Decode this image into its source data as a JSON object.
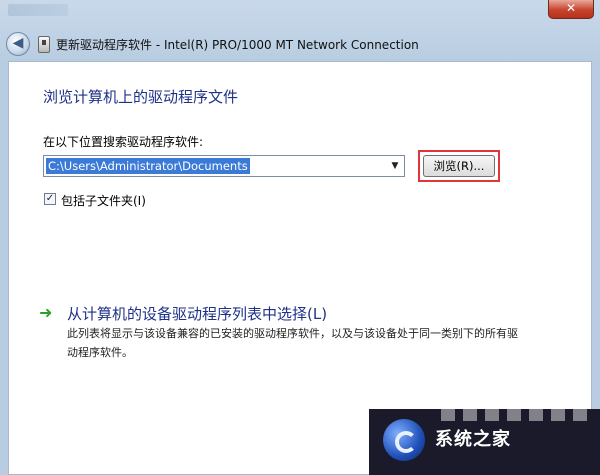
{
  "window": {
    "title": "更新驱动程序软件 - Intel(R) PRO/1000 MT Network Connection",
    "close_glyph": "✕",
    "back_glyph": "◀"
  },
  "main": {
    "heading": "浏览计算机上的驱动程序文件",
    "search_label": "在以下位置搜索驱动程序软件:",
    "path_value": "C:\\Users\\Administrator\\Documents",
    "dropdown_glyph": "▼",
    "browse_label": "浏览(R)...",
    "include_subfolders_label": "包括子文件夹(I)",
    "include_subfolders_checked": "✓"
  },
  "pick_option": {
    "arrow_glyph": "➜",
    "title": "从计算机的设备驱动程序列表中选择(L)",
    "description": "此列表将显示与该设备兼容的已安装的驱动程序软件，以及与该设备处于同一类别下的所有驱动程序软件。"
  },
  "watermark": {
    "text": "系统之家"
  },
  "colors": {
    "heading_blue": "#1e3287",
    "highlight_red": "#e0353a",
    "selection_blue": "#3b7ad6",
    "link_arrow_green": "#2aa12a"
  }
}
